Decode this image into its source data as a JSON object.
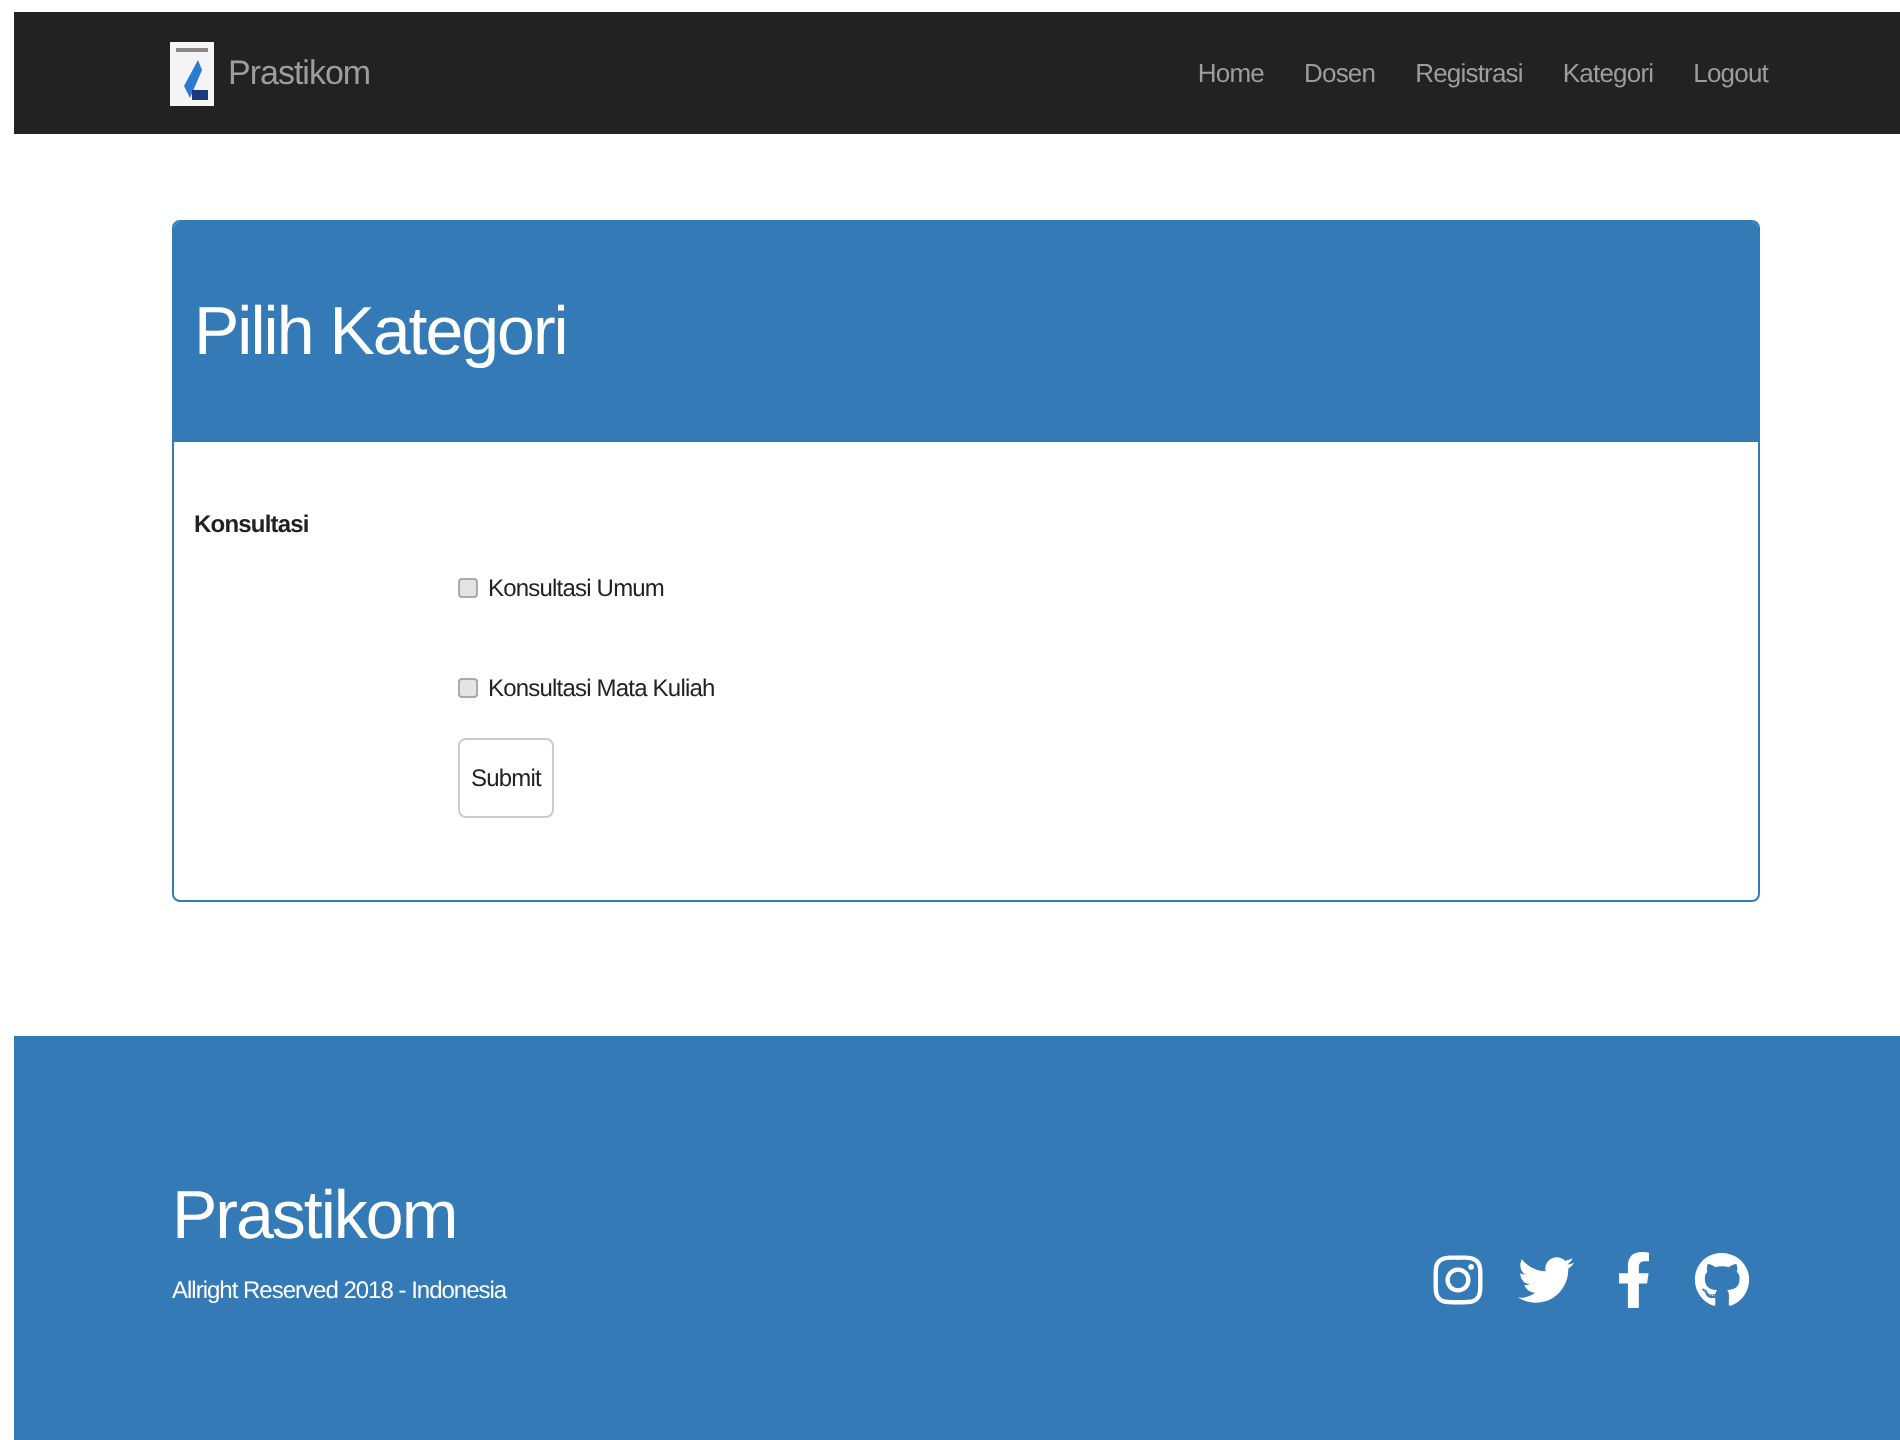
{
  "navbar": {
    "brand": "Prastikom",
    "links": [
      "Home",
      "Dosen",
      "Registrasi",
      "Kategori",
      "Logout"
    ]
  },
  "panel": {
    "title": "Pilih Kategori",
    "group_label": "Konsultasi",
    "options": [
      {
        "label": "Konsultasi Umum",
        "checked": false
      },
      {
        "label": "Konsultasi Mata Kuliah",
        "checked": false
      }
    ],
    "submit": "Submit"
  },
  "footer": {
    "title": "Prastikom",
    "copyright": "Allright Reserved 2018 - Indonesia"
  }
}
